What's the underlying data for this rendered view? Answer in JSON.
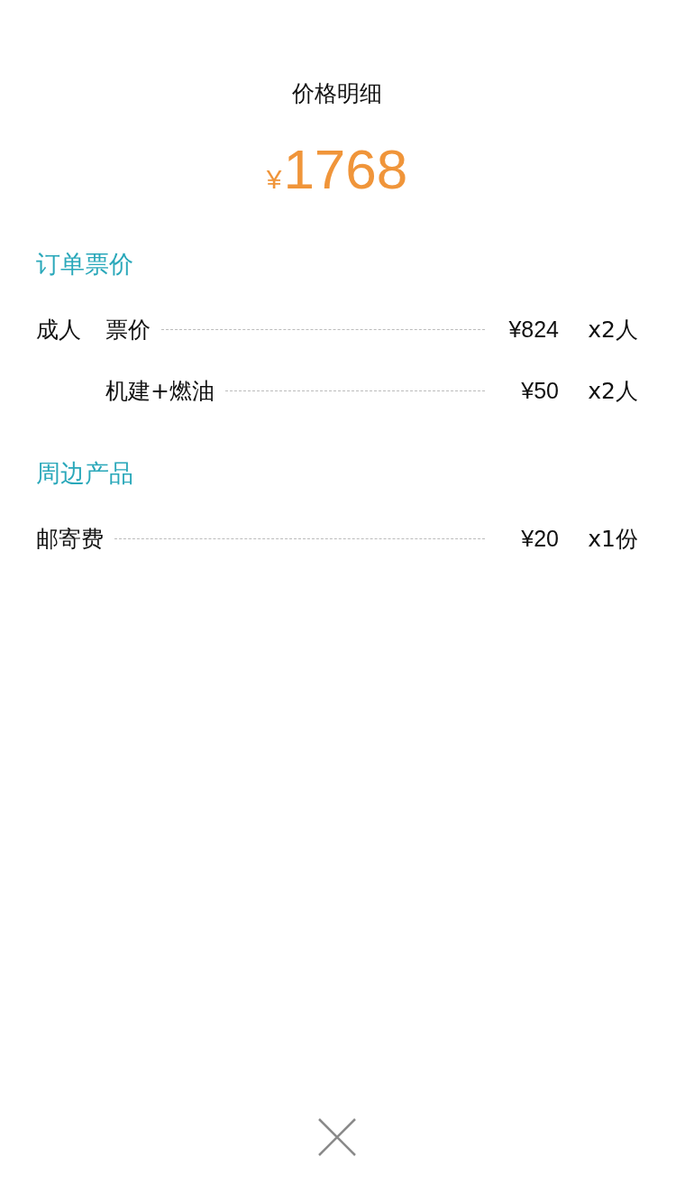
{
  "title": "价格明细",
  "total": {
    "currency": "¥",
    "amount": "1768"
  },
  "sections": [
    {
      "title": "订单票价",
      "rows": [
        {
          "kind": "grouped",
          "label": "成人",
          "item": "票价",
          "price": "¥824",
          "quantity": "x2人"
        },
        {
          "kind": "grouped",
          "item": "机建+燃油",
          "price": "¥50",
          "quantity": "x2人"
        }
      ]
    },
    {
      "title": "周边产品",
      "rows": [
        {
          "kind": "plain",
          "item": "邮寄费",
          "price": "¥20",
          "quantity": "x1份"
        }
      ]
    }
  ]
}
